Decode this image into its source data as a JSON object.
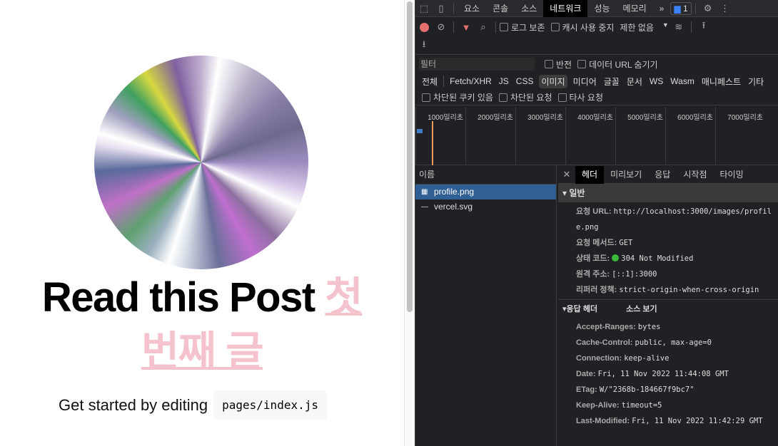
{
  "page": {
    "title_main": "Read this Post",
    "title_link": "첫 번째 글",
    "get_started": "Get started by editing",
    "code": "pages/index.js"
  },
  "devtools": {
    "tabs": [
      "요소",
      "콘솔",
      "소스",
      "네트워크",
      "성능",
      "메모리"
    ],
    "more_tabs": "»",
    "issues_count": "1",
    "toolbar": {
      "preserve_log": "로그 보존",
      "disable_cache": "캐시 사용 중지",
      "throttle": "제한 없음"
    },
    "filter": {
      "placeholder": "필터",
      "invert": "반전",
      "hide_data_urls": "데이터 URL 숨기기"
    },
    "types": [
      "전체",
      "Fetch/XHR",
      "JS",
      "CSS",
      "이미지",
      "미디어",
      "글꼴",
      "문서",
      "WS",
      "Wasm",
      "매니페스트",
      "기타"
    ],
    "active_type": "이미지",
    "blocked": {
      "cookies": "차단된 쿠키 있음",
      "requests": "차단된 요청",
      "third_party": "타사 요청"
    },
    "timeline": [
      "1000밀리초",
      "2000밀리초",
      "3000밀리초",
      "4000밀리초",
      "5000밀리초",
      "6000밀리초",
      "7000밀리초"
    ],
    "name_header": "이름",
    "requests": [
      {
        "name": "profile.png",
        "selected": true
      },
      {
        "name": "vercel.svg",
        "selected": false
      }
    ],
    "detail_tabs": [
      "헤더",
      "미리보기",
      "응답",
      "시작점",
      "타이밍"
    ],
    "general": {
      "title": "일반",
      "rows": [
        {
          "k": "요청 URL:",
          "v": "http://localhost:3000/images/profile.png"
        },
        {
          "k": "요청 메서드:",
          "v": "GET"
        },
        {
          "k": "상태 코드:",
          "v": "304 Not Modified"
        },
        {
          "k": "원격 주소:",
          "v": "[::1]:3000"
        },
        {
          "k": "리퍼러 정책:",
          "v": "strict-origin-when-cross-origin"
        }
      ]
    },
    "response_headers": {
      "title": "응답 헤더",
      "view_source": "소스 보기",
      "rows": [
        {
          "k": "Accept-Ranges:",
          "v": "bytes"
        },
        {
          "k": "Cache-Control:",
          "v": "public, max-age=0"
        },
        {
          "k": "Connection:",
          "v": "keep-alive"
        },
        {
          "k": "Date:",
          "v": "Fri, 11 Nov 2022 11:44:08 GMT"
        },
        {
          "k": "ETag:",
          "v": "W/\"2368b-184667f9bc7\""
        },
        {
          "k": "Keep-Alive:",
          "v": "timeout=5"
        },
        {
          "k": "Last-Modified:",
          "v": "Fri, 11 Nov 2022 11:42:29 GMT"
        }
      ]
    },
    "colors": {
      "status_ok": "#3cba3c",
      "record": "#e46f6f",
      "selected_row": "#2f5f93",
      "link_pink": "#f4c3cd"
    }
  }
}
